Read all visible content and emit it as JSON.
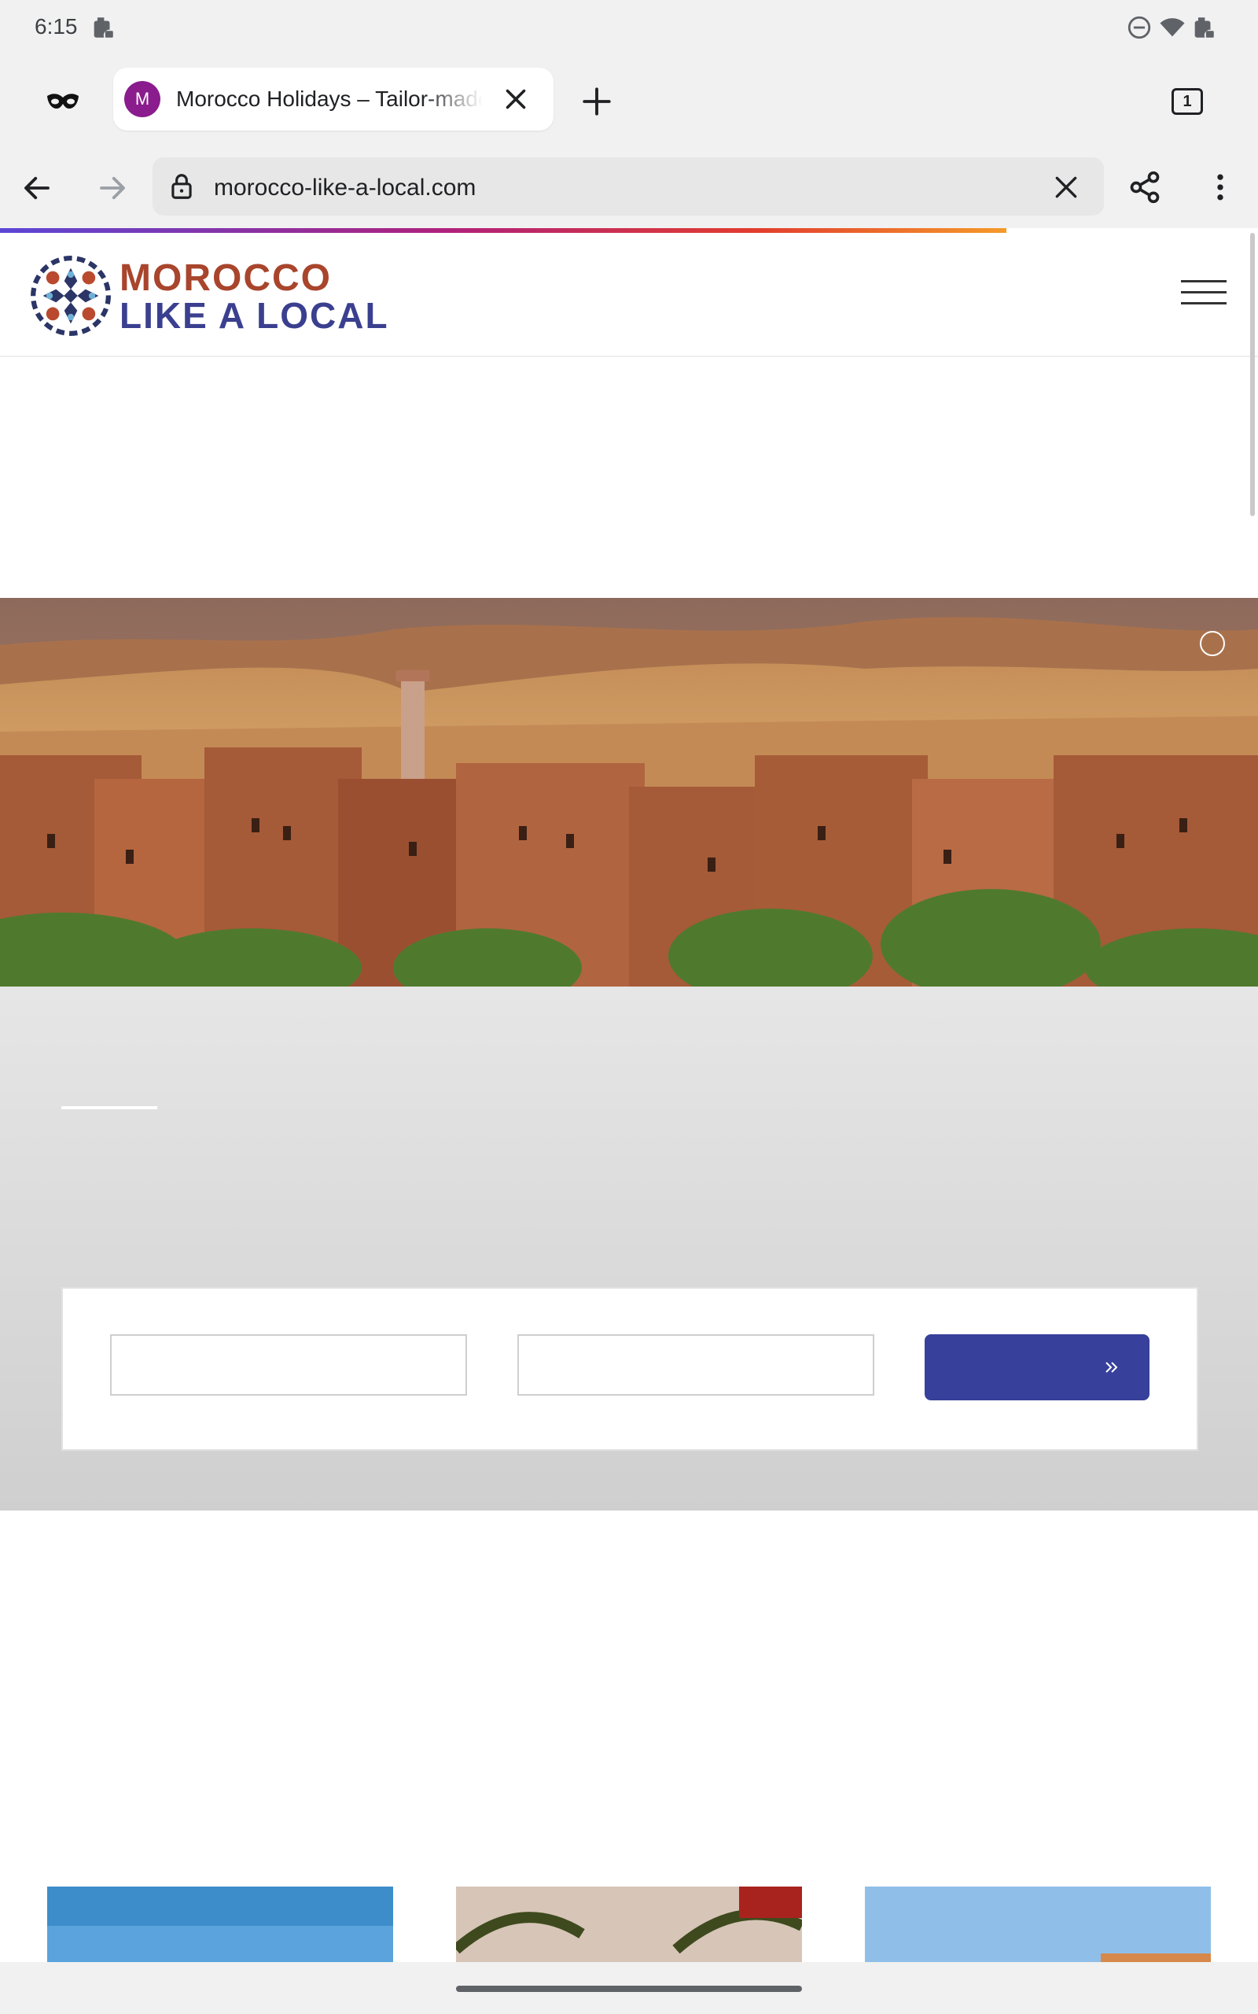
{
  "status_bar": {
    "time": "6:15"
  },
  "browser": {
    "tab": {
      "title": "Morocco Holidays – Tailor-made",
      "favicon_letter": "M",
      "favicon_color": "#8a1c8d"
    },
    "tab_count": "1",
    "url": "morocco-like-a-local.com"
  },
  "site": {
    "logo_line1": "MOROCCO",
    "logo_line2": "LIKE A LOCAL",
    "brand_colors": {
      "primary_blue": "#37409a",
      "terracotta": "#a8452c"
    }
  },
  "icons": {
    "incognito": "incognito-icon",
    "back": "back-arrow-icon",
    "forward": "forward-arrow-icon",
    "lock": "lock-icon",
    "share": "share-icon",
    "menu": "hamburger-menu-icon"
  }
}
